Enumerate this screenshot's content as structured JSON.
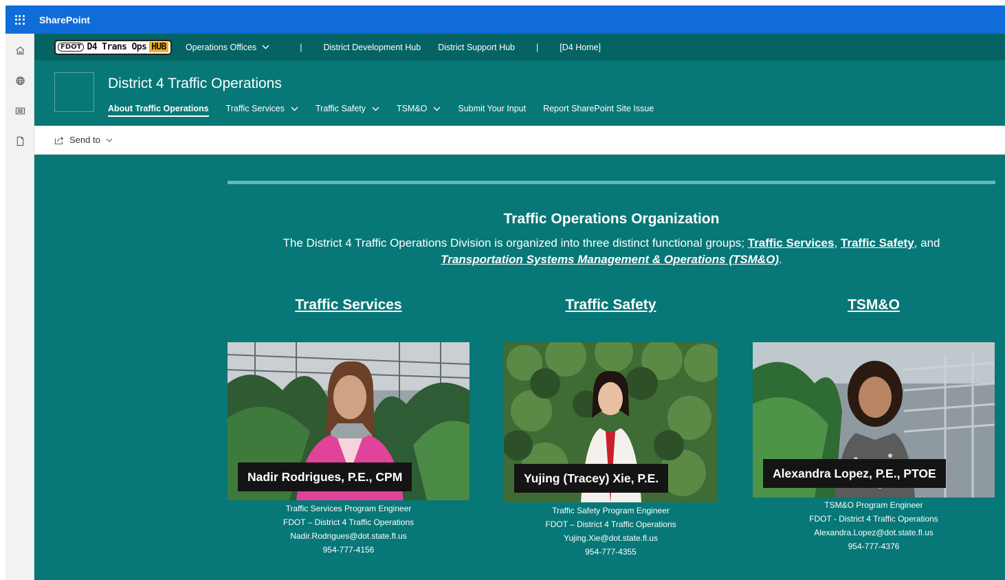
{
  "suite": {
    "app_name": "SharePoint"
  },
  "rail": {
    "icons": [
      "home-icon",
      "globe-icon",
      "news-icon",
      "file-icon"
    ]
  },
  "hub_nav": {
    "logo": {
      "badge": "FDOT",
      "text": "D4 Trans Ops",
      "hub": "HUB"
    },
    "items": [
      "Operations Offices",
      "|",
      "District Development Hub",
      "District Support Hub",
      "|",
      "[D4 Home]"
    ]
  },
  "site": {
    "title": "District 4 Traffic Operations",
    "nav": [
      "About Traffic Operations",
      "Traffic Services",
      "Traffic Safety",
      "TSM&O",
      "Submit Your Input",
      "Report SharePoint Site Issue"
    ]
  },
  "command_bar": {
    "send_to": "Send to"
  },
  "content": {
    "org_title": "Traffic Operations Organization",
    "desc_prefix": "The District 4 Traffic Operations Division is organized into three distinct functional groups; ",
    "desc_link1": "Traffic Services",
    "desc_sep1": ", ",
    "desc_link2": "Traffic Safety",
    "desc_sep2": ", and",
    "desc_link3": "Transportation Systems Management & Operations (TSM&O)",
    "desc_suffix": ".",
    "columns": [
      {
        "heading": "Traffic Services",
        "name": "Nadir Rodrigues, P.E., CPM",
        "role": "Traffic Services Program Engineer",
        "org": "FDOT – District 4 Traffic Operations",
        "email": "Nadir.Rodrigues@dot.state.fl.us",
        "phone": "954-777-4156"
      },
      {
        "heading": "Traffic Safety",
        "name": "Yujing (Tracey) Xie, P.E.",
        "role": "Traffic Safety Program Engineer",
        "org": "FDOT – District 4 Traffic Operations",
        "email": "Yujing.Xie@dot.state.fl.us",
        "phone": "954-777-4355"
      },
      {
        "heading": "TSM&O",
        "name": "Alexandra Lopez, P.E., PTOE",
        "role": "TSM&O Program Engineer",
        "org": "FDOT - District 4 Traffic Operations",
        "email": "Alexandra.Lopez@dot.state.fl.us",
        "phone": "954-777-4376"
      }
    ]
  },
  "colors": {
    "suite_bar": "#0f6cd8",
    "hub_nav": "#066363",
    "theme": "#077777",
    "divider": "#66b8b8",
    "logo_hub": "#f2b21b"
  }
}
